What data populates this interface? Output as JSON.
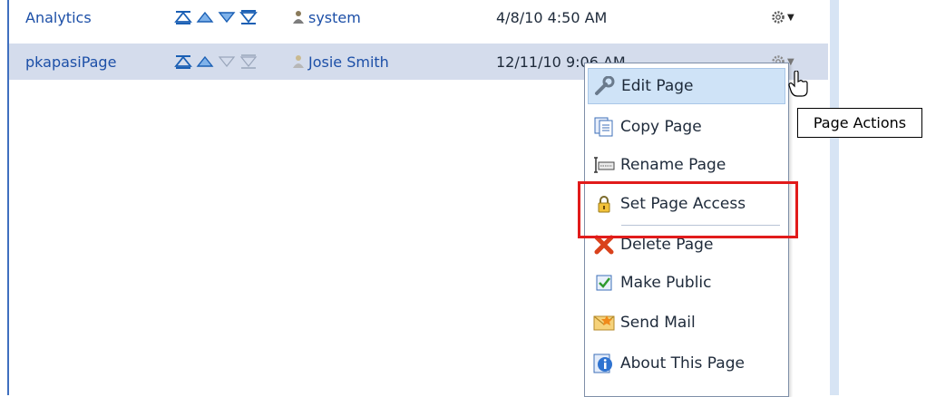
{
  "rows": [
    {
      "name": "Analytics",
      "owner": "system",
      "date": "4/8/10 4:50 AM"
    },
    {
      "name": "pkapasiPage",
      "owner": "Josie Smith",
      "date": "12/11/10 9:06 AM"
    }
  ],
  "icons": {
    "move_top": "double-up-triangle-icon",
    "move_up": "up-triangle-icon",
    "move_down": "down-triangle-icon",
    "move_bottom": "double-down-triangle-icon",
    "owner": "user-icon",
    "actions": "gear-icon"
  },
  "menu": {
    "items": [
      {
        "label": "Edit Page",
        "icon": "wrench-icon"
      },
      {
        "label": "Copy Page",
        "icon": "copy-icon"
      },
      {
        "label": "Rename Page",
        "icon": "rename-icon"
      },
      {
        "label": "Set Page Access",
        "icon": "lock-icon"
      },
      {
        "label": "Delete Page",
        "icon": "delete-icon"
      },
      {
        "label": "Make Public",
        "icon": "check-icon"
      },
      {
        "label": "Send Mail",
        "icon": "mail-icon"
      },
      {
        "label": "About This Page",
        "icon": "info-icon"
      }
    ]
  },
  "tooltip": {
    "text": "Page Actions"
  },
  "colors": {
    "link": "#1c4fa7",
    "selected_row": "#d4dcec",
    "highlight": "#e11b1b"
  }
}
